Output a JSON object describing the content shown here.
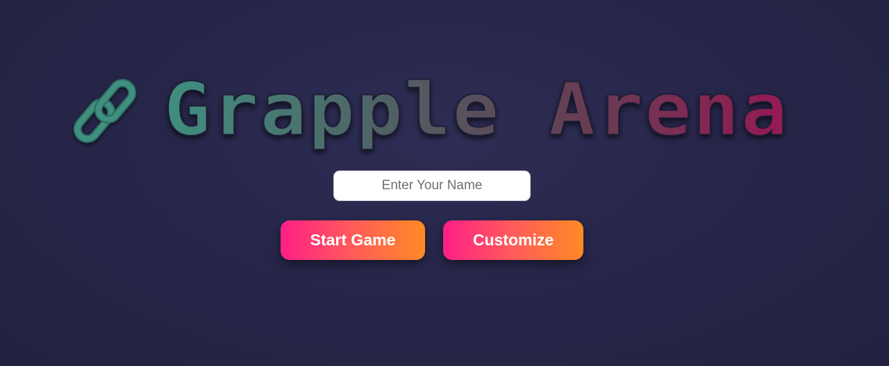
{
  "title": {
    "text": "Grapple Arena",
    "icon": "chain-link-icon",
    "gradient_colors": [
      "#3f8f7f",
      "#5a5a62",
      "#8a1e50"
    ],
    "icon_color": "#3f8f7f"
  },
  "name_input": {
    "placeholder": "Enter Your Name",
    "value": ""
  },
  "buttons": {
    "start_label": "Start Game",
    "customize_label": "Customize"
  },
  "colors": {
    "background": "#27264a",
    "button_gradient_start": "#ff1f86",
    "button_gradient_end": "#ff8a24"
  }
}
